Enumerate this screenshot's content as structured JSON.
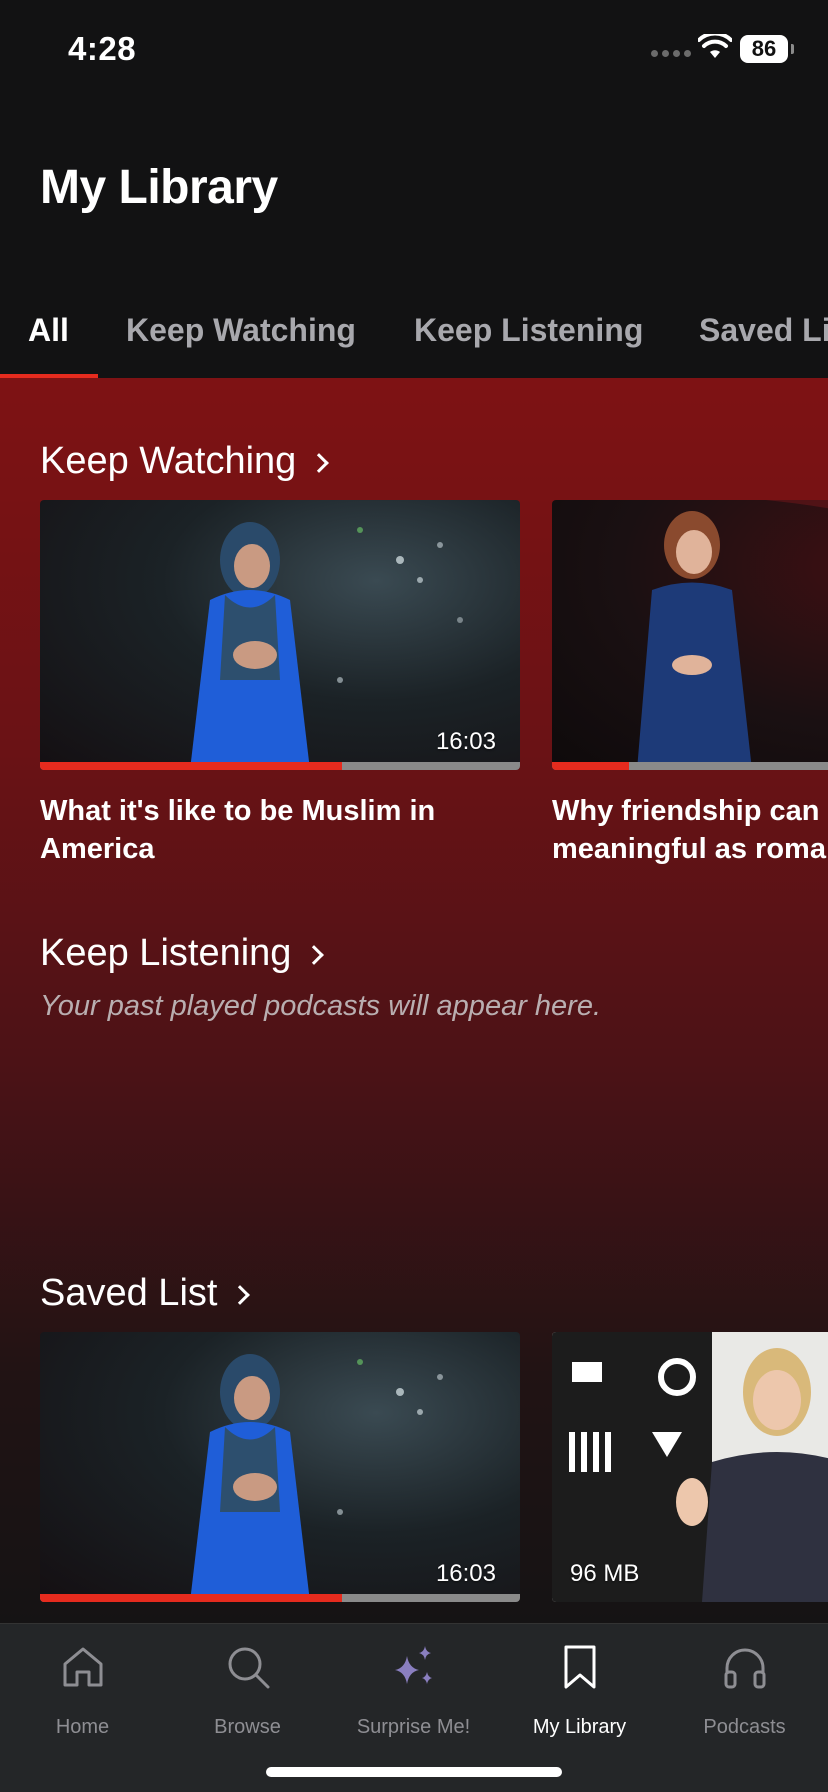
{
  "status_bar": {
    "time": "4:28",
    "battery": "86"
  },
  "page_title": "My Library",
  "tabs": [
    {
      "label": "All",
      "active": true
    },
    {
      "label": "Keep Watching",
      "active": false
    },
    {
      "label": "Keep Listening",
      "active": false
    },
    {
      "label": "Saved Li",
      "active": false
    }
  ],
  "sections": {
    "keep_watching": {
      "title": "Keep Watching",
      "items": [
        {
          "title": "What it's like to be Muslim in America",
          "duration": "16:03",
          "progress": 0.63
        },
        {
          "title": "Why friendship can be as meaningful as roma",
          "duration": "",
          "progress": 0.16
        }
      ]
    },
    "keep_listening": {
      "title": "Keep Listening",
      "empty_message": "Your past played podcasts will appear here."
    },
    "saved_list": {
      "title": "Saved List",
      "items": [
        {
          "duration": "16:03",
          "progress": 0.63
        },
        {
          "size": "96 MB"
        }
      ]
    }
  },
  "bottom_nav": [
    {
      "label": "Home",
      "icon": "home-icon"
    },
    {
      "label": "Browse",
      "icon": "search-icon"
    },
    {
      "label": "Surprise Me!",
      "icon": "sparkles-icon"
    },
    {
      "label": "My Library",
      "icon": "bookmark-icon",
      "active": true
    },
    {
      "label": "Podcasts",
      "icon": "headphones-icon"
    }
  ],
  "colors": {
    "accent": "#e62b1e",
    "background": "#121213",
    "nav_background": "#242628",
    "sparkle": "#8a7fc0"
  }
}
